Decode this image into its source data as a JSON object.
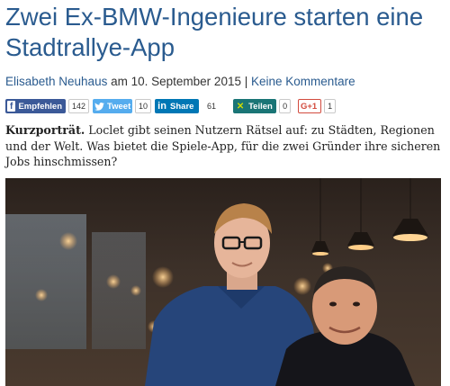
{
  "article": {
    "title": "Zwei Ex-BMW-Ingenieure starten eine Stadtrallye-App",
    "author": "Elisabeth Neuhaus",
    "date_prefix": "am",
    "date": "10. September 2015",
    "separator": "|",
    "comments_link": "Keine Kommentare",
    "intro_lead": "Kurzporträt.",
    "intro_text": "Loclet gibt seinen Nutzern Rätsel auf: zu Städten, Regionen und der Welt. Was bietet die Spiele-App, für die zwei Gründer ihre sicheren Jobs hinschmissen?"
  },
  "share": {
    "facebook": {
      "label": "Empfehlen",
      "count": "142",
      "icon": "facebook-icon"
    },
    "twitter": {
      "label": "Tweet",
      "count": "10",
      "icon": "twitter-icon"
    },
    "linkedin": {
      "label": "Share",
      "count": "61",
      "icon": "linkedin-icon"
    },
    "xing": {
      "label": "Teilen",
      "count": "0",
      "icon": "xing-icon"
    },
    "googleplus": {
      "label": "G+1",
      "count": "1",
      "icon": "googleplus-icon"
    }
  },
  "colors": {
    "title": "#2a5b8f",
    "facebook": "#3b5998",
    "twitter": "#55acee",
    "linkedin": "#0077b5",
    "xing": "#1a7576",
    "googleplus": "#d24b3e"
  }
}
